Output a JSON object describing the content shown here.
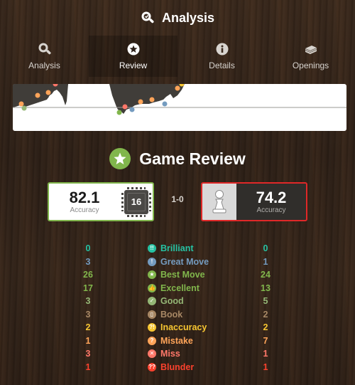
{
  "header": {
    "title": "Analysis"
  },
  "tabs": [
    {
      "label": "Analysis",
      "icon": "magnifier-icon",
      "active": false
    },
    {
      "label": "Review",
      "icon": "star-icon",
      "active": true
    },
    {
      "label": "Details",
      "icon": "info-icon",
      "active": false
    },
    {
      "label": "Openings",
      "icon": "book-stack-icon",
      "active": false
    }
  ],
  "review": {
    "title": "Game Review",
    "result": "1-0",
    "white": {
      "accuracy": "82.1",
      "accuracy_label": "Accuracy",
      "bot_level": "16"
    },
    "black": {
      "accuracy": "74.2",
      "accuracy_label": "Accuracy"
    }
  },
  "classifications": [
    {
      "name": "Brilliant",
      "white": "0",
      "black": "0",
      "color": "#26c2a3",
      "glyph": "!!"
    },
    {
      "name": "Great Move",
      "white": "3",
      "black": "1",
      "color": "#749bbf",
      "glyph": "!"
    },
    {
      "name": "Best Move",
      "white": "26",
      "black": "24",
      "color": "#81b64c",
      "glyph": "★"
    },
    {
      "name": "Excellent",
      "white": "17",
      "black": "13",
      "color": "#81b64c",
      "glyph": "👍"
    },
    {
      "name": "Good",
      "white": "3",
      "black": "5",
      "color": "#95b776",
      "glyph": "✓"
    },
    {
      "name": "Book",
      "white": "3",
      "black": "2",
      "color": "#a88865",
      "glyph": "▯"
    },
    {
      "name": "Inaccuracy",
      "white": "2",
      "black": "2",
      "color": "#f7c631",
      "glyph": "?!"
    },
    {
      "name": "Mistake",
      "white": "1",
      "black": "7",
      "color": "#ffa459",
      "glyph": "?"
    },
    {
      "name": "Miss",
      "white": "3",
      "black": "1",
      "color": "#ff7769",
      "glyph": "✕"
    },
    {
      "name": "Blunder",
      "white": "1",
      "black": "1",
      "color": "#fa412d",
      "glyph": "??"
    }
  ],
  "colors": {
    "accent_green": "#81b64c",
    "black_border": "#e02828",
    "graph_dark": "#403d39"
  }
}
